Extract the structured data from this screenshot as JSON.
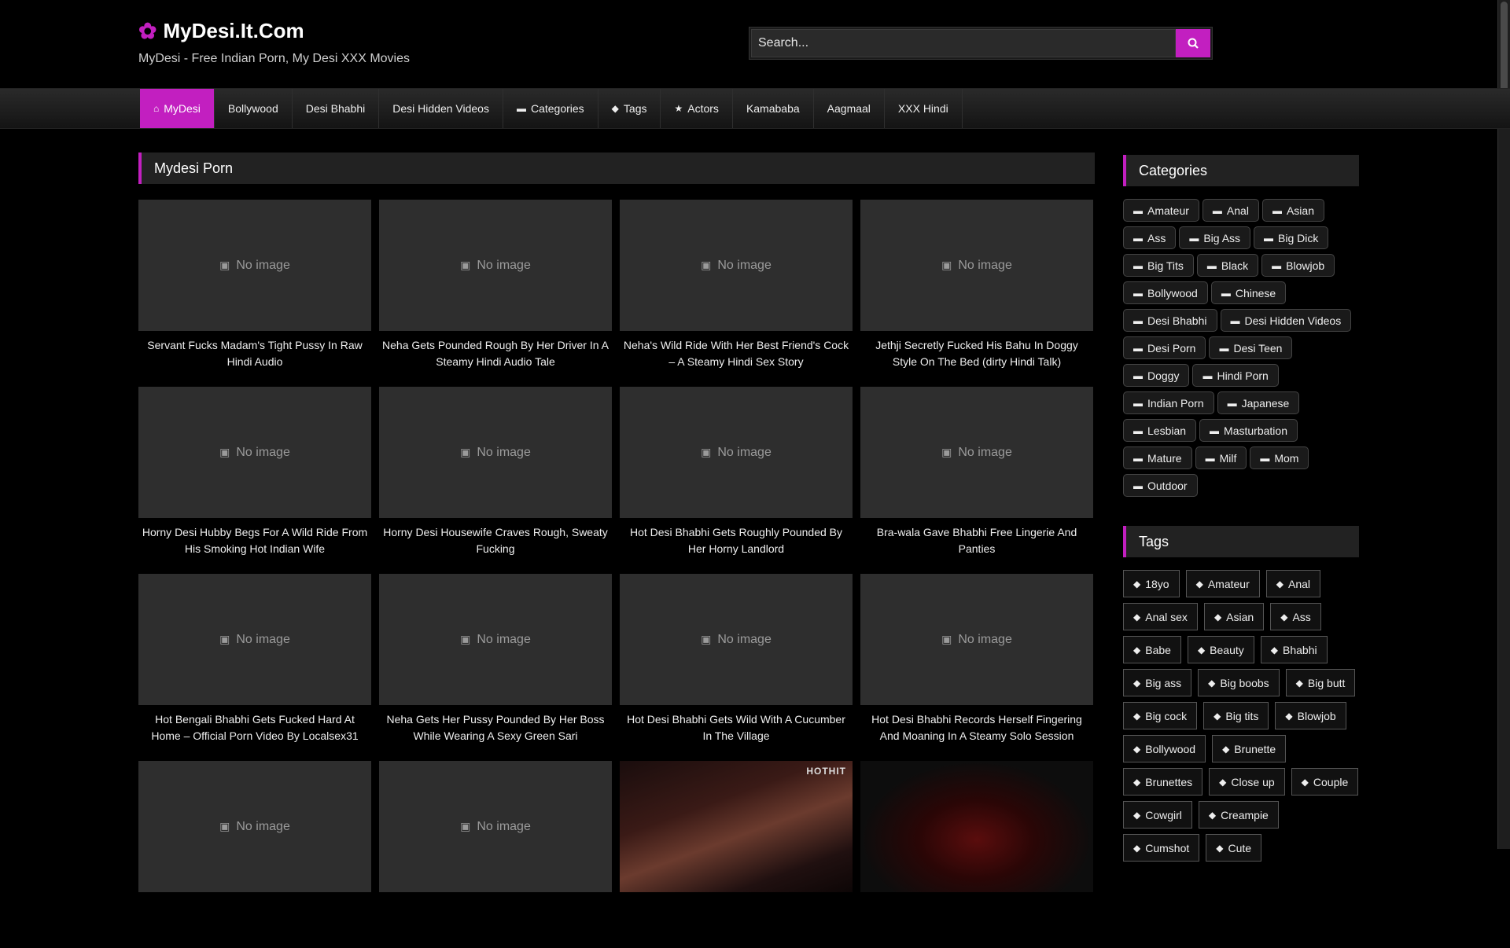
{
  "header": {
    "site_name": "MyDesi.It.Com",
    "tagline": "MyDesi - Free Indian Porn, My Desi XXX Movies",
    "search_placeholder": "Search..."
  },
  "nav": [
    {
      "label": "MyDesi",
      "icon": "home-icon",
      "active": true
    },
    {
      "label": "Bollywood"
    },
    {
      "label": "Desi Bhabhi"
    },
    {
      "label": "Desi Hidden Videos"
    },
    {
      "label": "Categories",
      "icon": "folder-icon"
    },
    {
      "label": "Tags",
      "icon": "tag-icon"
    },
    {
      "label": "Actors",
      "icon": "star-icon"
    },
    {
      "label": "Kamababa"
    },
    {
      "label": "Aagmaal"
    },
    {
      "label": "XXX Hindi"
    }
  ],
  "main": {
    "section_title": "Mydesi Porn",
    "no_image_text": "No image",
    "videos": [
      {
        "title": "Servant Fucks Madam's Tight Pussy In Raw Hindi Audio"
      },
      {
        "title": "Neha Gets Pounded Rough By Her Driver In A Steamy Hindi Audio Tale"
      },
      {
        "title": "Neha's Wild Ride With Her Best Friend's Cock – A Steamy Hindi Sex Story"
      },
      {
        "title": "Jethji Secretly Fucked His Bahu In Doggy Style On The Bed (dirty Hindi Talk)"
      },
      {
        "title": "Horny Desi Hubby Begs For A Wild Ride From His Smoking Hot Indian Wife"
      },
      {
        "title": "Horny Desi Housewife Craves Rough, Sweaty Fucking"
      },
      {
        "title": "Hot Desi Bhabhi Gets Roughly Pounded By Her Horny Landlord"
      },
      {
        "title": "Bra-wala Gave Bhabhi Free Lingerie And Panties"
      },
      {
        "title": "Hot Bengali Bhabhi Gets Fucked Hard At Home – Official Porn Video By Localsex31"
      },
      {
        "title": "Neha Gets Her Pussy Pounded By Her Boss While Wearing A Sexy Green Sari"
      },
      {
        "title": "Hot Desi Bhabhi Gets Wild With A Cucumber In The Village"
      },
      {
        "title": "Hot Desi Bhabhi Records Herself Fingering And Moaning In A Steamy Solo Session"
      },
      {
        "title": "",
        "thumb": "none"
      },
      {
        "title": "",
        "thumb": "none"
      },
      {
        "title": "",
        "thumb": "photo",
        "watermark": "HOTHIT"
      },
      {
        "title": "",
        "thumb": "photo"
      }
    ]
  },
  "sidebar": {
    "categories_title": "Categories",
    "categories": [
      "Amateur",
      "Anal",
      "Asian",
      "Ass",
      "Big Ass",
      "Big Dick",
      "Big Tits",
      "Black",
      "Blowjob",
      "Bollywood",
      "Chinese",
      "Desi Bhabhi",
      "Desi Hidden Videos",
      "Desi Porn",
      "Desi Teen",
      "Doggy",
      "Hindi Porn",
      "Indian Porn",
      "Japanese",
      "Lesbian",
      "Masturbation",
      "Mature",
      "Milf",
      "Mom",
      "Outdoor"
    ],
    "tags_title": "Tags",
    "tags": [
      "18yo",
      "Amateur",
      "Anal",
      "Anal sex",
      "Asian",
      "Ass",
      "Babe",
      "Beauty",
      "Bhabhi",
      "Big ass",
      "Big boobs",
      "Big butt",
      "Big cock",
      "Big tits",
      "Blowjob",
      "Bollywood",
      "Brunette",
      "Brunettes",
      "Close up",
      "Couple",
      "Cowgirl",
      "Creampie",
      "Cumshot",
      "Cute"
    ]
  },
  "colors": {
    "accent": "#c21fc0",
    "background": "#000000"
  }
}
